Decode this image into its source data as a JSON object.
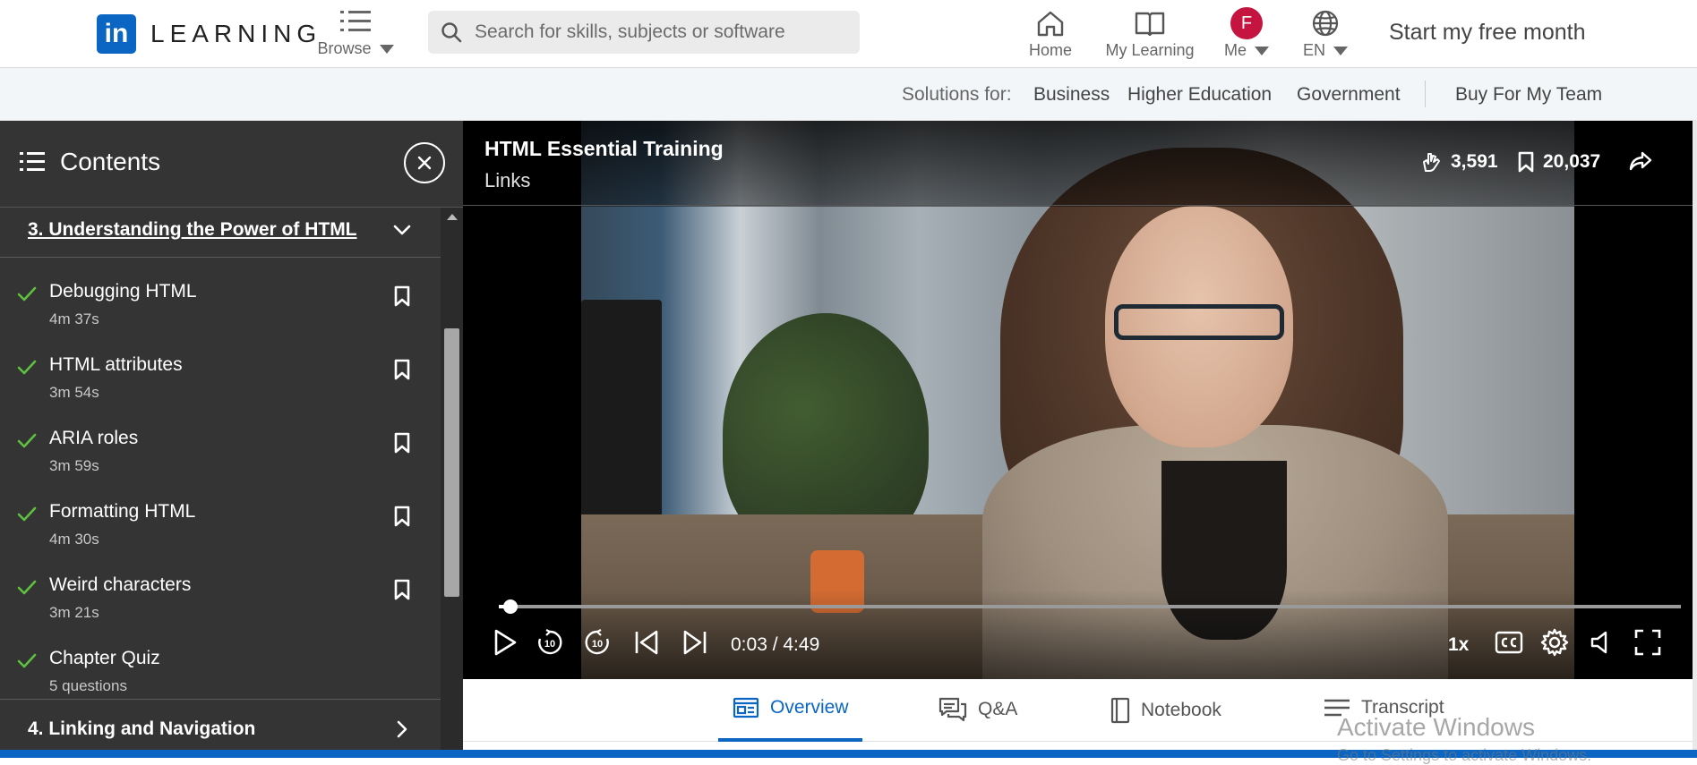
{
  "colors": {
    "brand": "#0a66c2",
    "sidebar_bg": "#343434",
    "check_green": "#5fbf3f",
    "avatar_bg": "#c4143f"
  },
  "header": {
    "logo_mark": "in",
    "logo_text": "LEARNING",
    "browse_label": "Browse",
    "search_placeholder": "Search for skills, subjects or software",
    "nav": {
      "home": "Home",
      "my_learning": "My Learning",
      "me": "Me",
      "avatar_initial": "F",
      "language": "EN"
    },
    "cta": "Start my free month"
  },
  "subnav": {
    "label": "Solutions for:",
    "links": [
      "Business",
      "Higher Education",
      "Government"
    ],
    "buy": "Buy For My Team"
  },
  "sidebar": {
    "title": "Contents",
    "current_chapter": "3. Understanding the Power of HTML",
    "lessons": [
      {
        "title": "Debugging HTML",
        "duration": "4m 37s"
      },
      {
        "title": "HTML attributes",
        "duration": "3m 54s"
      },
      {
        "title": "ARIA roles",
        "duration": "3m 59s"
      },
      {
        "title": "Formatting HTML",
        "duration": "4m 30s"
      },
      {
        "title": "Weird characters",
        "duration": "3m 21s"
      },
      {
        "title": "Chapter Quiz",
        "duration": "5 questions"
      }
    ],
    "next_chapter": "4. Linking and Navigation"
  },
  "video": {
    "course_title": "HTML Essential Training",
    "lesson_title": "Links",
    "likes": "3,591",
    "saves": "20,037",
    "current_time": "0:03",
    "duration": "4:49",
    "time_display": "0:03 / 4:49",
    "progress": 0.01,
    "speed": "1x",
    "skip_seconds": "10"
  },
  "tabs": {
    "overview": "Overview",
    "qa": "Q&A",
    "notebook": "Notebook",
    "transcript": "Transcript"
  },
  "overlay": {
    "activate_title": "Activate Windows",
    "activate_sub": "Go to Settings to activate Windows."
  }
}
